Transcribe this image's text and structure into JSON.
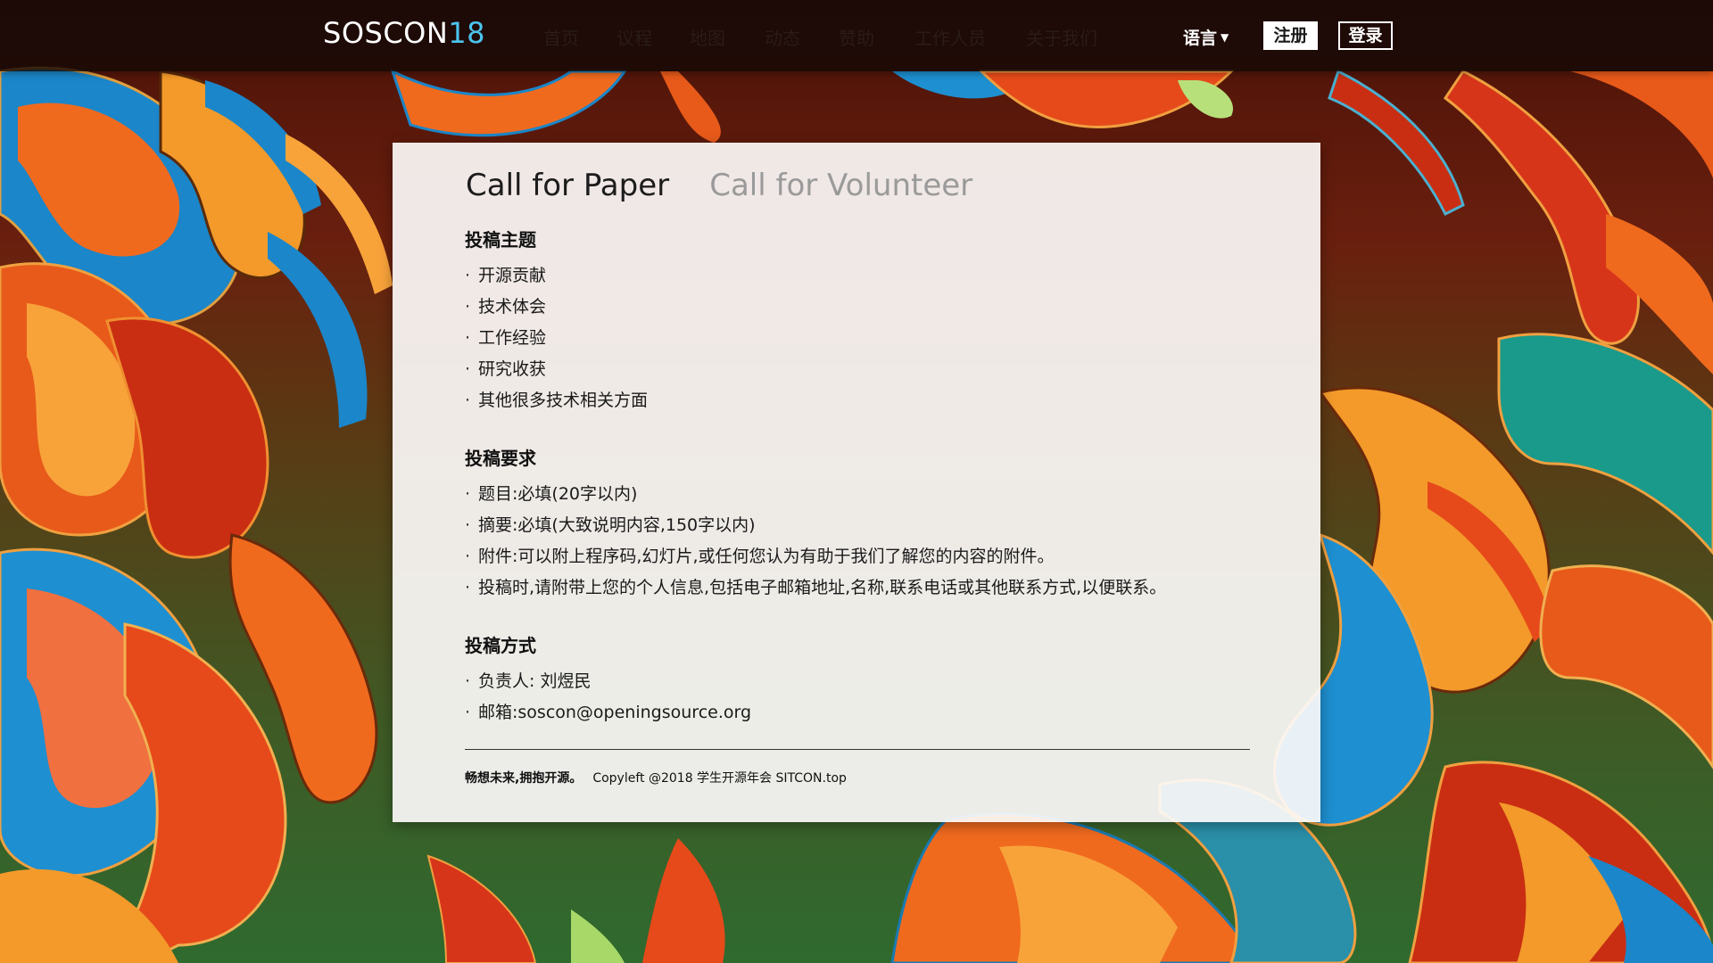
{
  "nav": {
    "logo_text": "SOSCON",
    "logo_number": "18",
    "items": [
      {
        "label": "首页"
      },
      {
        "label": "议程"
      },
      {
        "label": "地图"
      },
      {
        "label": "动态"
      },
      {
        "label": "赞助"
      },
      {
        "label": "工作人员"
      },
      {
        "label": "关于我们"
      }
    ],
    "language_label": "语言",
    "language_caret": "▼",
    "register_label": "注册",
    "login_label": "登录"
  },
  "tabs": [
    {
      "label": "Call for Paper",
      "active": true
    },
    {
      "label": "Call for Volunteer",
      "active": false
    }
  ],
  "sections": [
    {
      "title": "投稿主题",
      "items": [
        "开源贡献",
        "技术体会",
        "工作经验",
        "研究收获",
        "其他很多技术相关方面"
      ]
    },
    {
      "title": "投稿要求",
      "items": [
        "题目:必填(20字以内)",
        "摘要:必填(大致说明内容,150字以内)",
        "附件:可以附上程序码,幻灯片,或任何您认为有助于我们了解您的内容的附件。",
        "投稿时,请附带上您的个人信息,包括电子邮箱地址,名称,联系电话或其他联系方式,以便联系。"
      ]
    },
    {
      "title": "投稿方式",
      "items": [
        "负责人: 刘煜民",
        "邮箱:soscon@openingsource.org"
      ]
    }
  ],
  "bullet": "·",
  "footer": {
    "tagline": "畅想未来,拥抱开源。",
    "copyright": "Copyleft @2018 学生开源年会 SITCON.top"
  },
  "colors": {
    "logo_accent": "#4cc4ee",
    "topbar": "#140806",
    "card_bg": "#fcfaf8"
  }
}
